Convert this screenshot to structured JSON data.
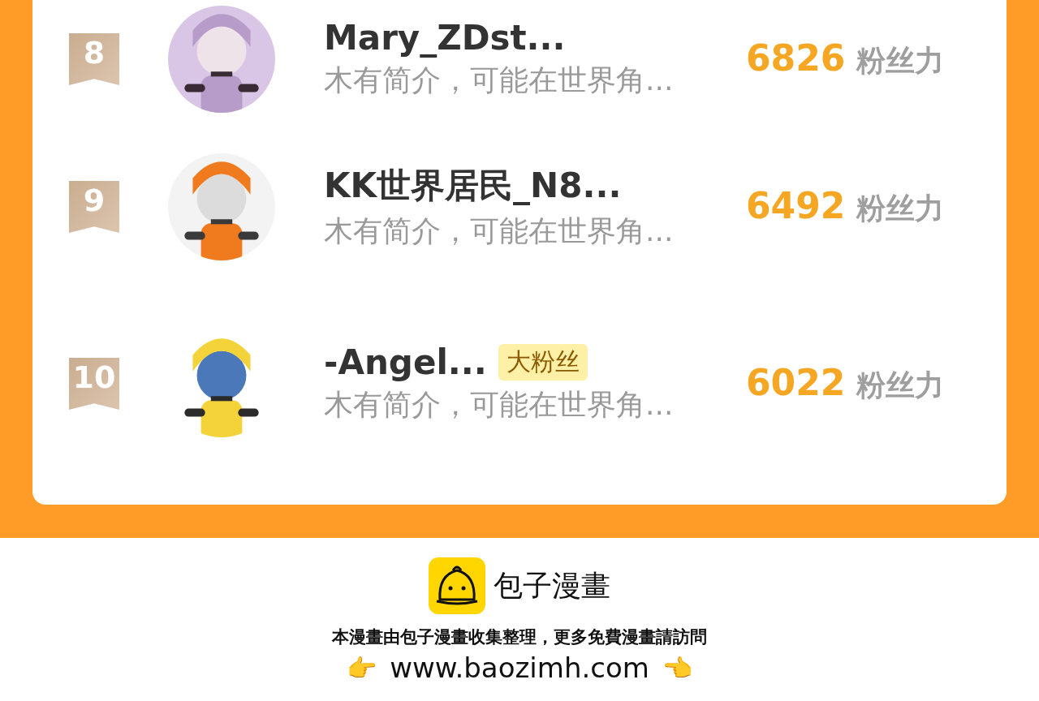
{
  "ranking": [
    {
      "rank": "8",
      "name": "Mary_ZDst...",
      "bio": "木有简介，可能在世界角...",
      "score": "6826",
      "score_unit": "粉丝力"
    },
    {
      "rank": "9",
      "name": "KK世界居民_N8...",
      "bio": "木有简介，可能在世界角...",
      "score": "6492",
      "score_unit": "粉丝力"
    },
    {
      "rank": "10",
      "name": "-Angel...",
      "badge": "大粉丝",
      "bio": "木有简介，可能在世界角...",
      "score": "6022",
      "score_unit": "粉丝力"
    }
  ],
  "footer": {
    "brand": "包子漫畫",
    "note": "本漫畫由包子漫畫收集整理，更多免費漫畫請訪問",
    "url_left_mark": "👉",
    "url": "www.baozimh.com",
    "url_right_mark": "👈"
  }
}
